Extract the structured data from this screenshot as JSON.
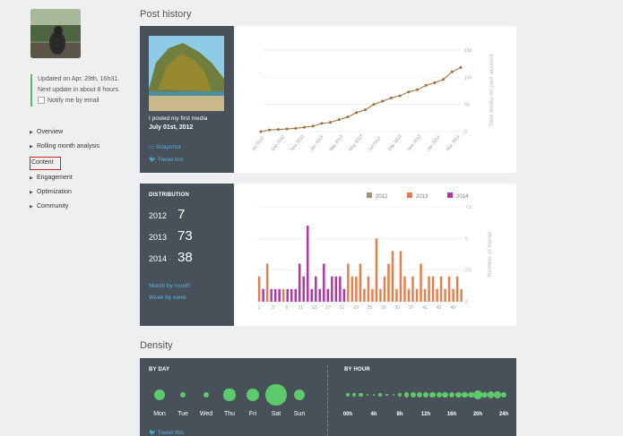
{
  "sidebar": {
    "update_line1": "Updated on Apr. 29th, 16h31.",
    "update_line2": "Next update in about 8 hours.",
    "notify_label": "Notify me by email",
    "nav": [
      "Overview",
      "Rolling month analysis",
      "Content",
      "Engagement",
      "Optimization",
      "Community"
    ],
    "active_index": 2
  },
  "post_history": {
    "title": "Post history",
    "first_media_text": "I posted my first media",
    "first_media_date": "July 01st, 2012",
    "snapshot_label": "Snapshot",
    "tweet_label": "Tweet this"
  },
  "distribution": {
    "title": "DISTRIBUTION",
    "rows": [
      {
        "year": "2012",
        "count": "7"
      },
      {
        "year": "2013",
        "count": "73"
      },
      {
        "year": "2014",
        "count": "38"
      }
    ],
    "link1": "Month by month",
    "link2": "Week by week"
  },
  "density": {
    "title": "Density",
    "by_day_title": "BY DAY",
    "by_hour_title": "BY HOUR",
    "days": [
      "Mon",
      "Tue",
      "Wed",
      "Thu",
      "Fri",
      "Sat",
      "Sun"
    ],
    "day_sizes": [
      1.0,
      0.55,
      0.55,
      1.05,
      1.1,
      1.9,
      1.0
    ],
    "hours": [
      "00h",
      "4h",
      "8h",
      "12h",
      "16h",
      "20h",
      "24h"
    ],
    "hour_sizes": [
      0.35,
      0.35,
      0.35,
      0.2,
      0.2,
      0.35,
      0.2,
      0.2,
      0.35,
      0.45,
      0.5,
      0.5,
      0.55,
      0.55,
      0.5,
      0.55,
      0.55,
      0.55,
      0.55,
      0.55,
      0.85,
      0.55,
      0.6,
      0.65,
      0.55
    ],
    "tweet_label": "Tweet this"
  },
  "chart_data": [
    {
      "type": "line",
      "ylabel": "Total media on your account",
      "ylim": [
        0,
        150
      ],
      "yticks": [
        "150",
        "100",
        "50",
        "0"
      ],
      "x": [
        "Jul 2012",
        "Sep 2012",
        "Nov 2012",
        "Jan 2013",
        "Mar 2013",
        "May 2013",
        "Jul 2013",
        "Sep 2013",
        "Nov 2013",
        "Jan 2014",
        "Mar 2014"
      ],
      "values": [
        0,
        3,
        4,
        5,
        6,
        8,
        10,
        15,
        17,
        22,
        27,
        35,
        40,
        50,
        56,
        62,
        66,
        73,
        77,
        85,
        90,
        96,
        110,
        118
      ],
      "color": "#a06a3a"
    },
    {
      "type": "bar",
      "ylabel": "Number of media",
      "ylim": [
        0,
        7.5
      ],
      "yticks": [
        "7.5",
        "5",
        "2.5",
        "0"
      ],
      "xticks": [
        "1",
        "3",
        "5",
        "11",
        "13",
        "17",
        "21",
        "23",
        "25",
        "29",
        "33",
        "37",
        "41",
        "45",
        "49"
      ],
      "series": [
        {
          "name": "2012",
          "color": "#a89070"
        },
        {
          "name": "2013",
          "color": "#e67e4c"
        },
        {
          "name": "2014",
          "color": "#b334a8"
        }
      ],
      "bars": [
        {
          "s": "2013",
          "v": 2
        },
        {
          "s": "2014",
          "v": 1
        },
        {
          "s": "2013",
          "v": 3
        },
        {
          "s": "2014",
          "v": 1
        },
        {
          "s": "2014",
          "v": 1
        },
        {
          "s": "2014",
          "v": 1
        },
        {
          "s": "2013",
          "v": 1
        },
        {
          "s": "2014",
          "v": 1
        },
        {
          "s": "2014",
          "v": 1
        },
        {
          "s": "2014",
          "v": 1
        },
        {
          "s": "2014",
          "v": 3
        },
        {
          "s": "2014",
          "v": 2
        },
        {
          "s": "2014",
          "v": 6
        },
        {
          "s": "2014",
          "v": 1
        },
        {
          "s": "2014",
          "v": 2
        },
        {
          "s": "2014",
          "v": 1
        },
        {
          "s": "2014",
          "v": 3
        },
        {
          "s": "2014",
          "v": 1
        },
        {
          "s": "2014",
          "v": 2
        },
        {
          "s": "2014",
          "v": 2
        },
        {
          "s": "2014",
          "v": 2
        },
        {
          "s": "2014",
          "v": 1
        },
        {
          "s": "2013",
          "v": 3
        },
        {
          "s": "2013",
          "v": 2
        },
        {
          "s": "2013",
          "v": 2
        },
        {
          "s": "2013",
          "v": 3
        },
        {
          "s": "2013",
          "v": 1
        },
        {
          "s": "2013",
          "v": 2
        },
        {
          "s": "2013",
          "v": 1
        },
        {
          "s": "2013",
          "v": 5
        },
        {
          "s": "2013",
          "v": 1
        },
        {
          "s": "2013",
          "v": 2
        },
        {
          "s": "2013",
          "v": 3
        },
        {
          "s": "2013",
          "v": 4
        },
        {
          "s": "2013",
          "v": 1
        },
        {
          "s": "2013",
          "v": 4
        },
        {
          "s": "2013",
          "v": 2
        },
        {
          "s": "2013",
          "v": 1
        },
        {
          "s": "2013",
          "v": 2
        },
        {
          "s": "2013",
          "v": 1
        },
        {
          "s": "2013",
          "v": 3
        },
        {
          "s": "2013",
          "v": 1
        },
        {
          "s": "2013",
          "v": 2
        },
        {
          "s": "2013",
          "v": 2
        },
        {
          "s": "2013",
          "v": 1
        },
        {
          "s": "2013",
          "v": 2
        },
        {
          "s": "2013",
          "v": 1
        },
        {
          "s": "2013",
          "v": 2
        },
        {
          "s": "2013",
          "v": 1
        },
        {
          "s": "2013",
          "v": 2
        },
        {
          "s": "2013",
          "v": 1
        }
      ]
    }
  ]
}
